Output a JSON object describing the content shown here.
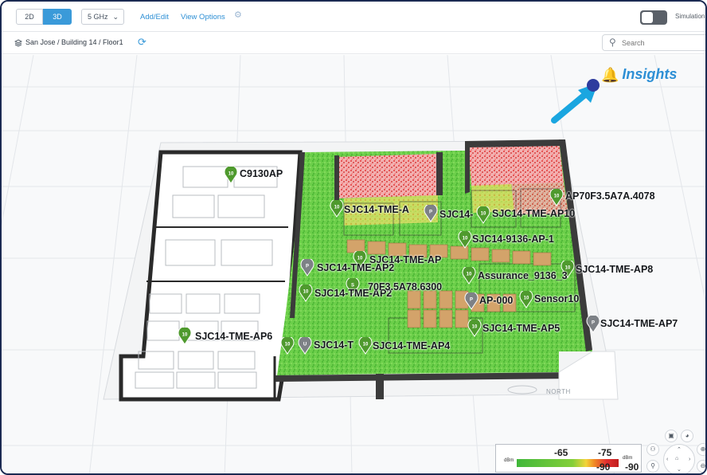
{
  "toolbar": {
    "view_2d": "2D",
    "view_3d": "3D",
    "band": "5 GHz",
    "add_edit": "Add/Edit",
    "view_options": "View Options",
    "simulation": "Simulation"
  },
  "breadcrumb": "San Jose / Building 14 / Floor1",
  "search": {
    "placeholder": "Search"
  },
  "insights": "Insights",
  "north": "NORTH",
  "aps": [
    {
      "label": "C9130AP"
    },
    {
      "label": "AP70F3.5A7A.4078"
    },
    {
      "label": "SJC14-TME-A"
    },
    {
      "label": "SJC14-"
    },
    {
      "label": "SJC14-TME-AP10"
    },
    {
      "label": "SJC14-9136-AP-1"
    },
    {
      "label": "SJC14-TME-AP"
    },
    {
      "label": "SJC14-TME-AP2"
    },
    {
      "label": "Assurance_9136_3"
    },
    {
      "label": "SJC14-TME-AP8"
    },
    {
      "label": "SJC14-TME-AP2"
    },
    {
      "label": "70F3.5A78.6300"
    },
    {
      "label": "AP-000"
    },
    {
      "label": "Sensor10"
    },
    {
      "label": "SJC14-TME-AP5"
    },
    {
      "label": "SJC14-TME-AP7"
    },
    {
      "label": "SJC14-TME-AP6"
    },
    {
      "label": "SJC14-T"
    },
    {
      "label": "SJC14-TME-AP4"
    }
  ],
  "pin_badges": [
    "10",
    "10",
    "10",
    "P",
    "10",
    "10",
    "10",
    "P",
    "10",
    "10",
    "10",
    "S",
    "P",
    "10",
    "P",
    "10",
    "10",
    "10",
    "U",
    "10"
  ],
  "legend": {
    "unit": "dBm",
    "high": "-65",
    "mid": "-75",
    "low_a": "-90",
    "low_b": "-90"
  },
  "colors": {
    "accent": "#3a9ad9",
    "insights": "#2d8fd5",
    "ap_pin_green": "#4f9a2e",
    "ap_pin_gray": "#7d8186",
    "arrow": "#1aa6e0",
    "strong_signal": "#41b73a",
    "weak_signal": "#e23030"
  }
}
